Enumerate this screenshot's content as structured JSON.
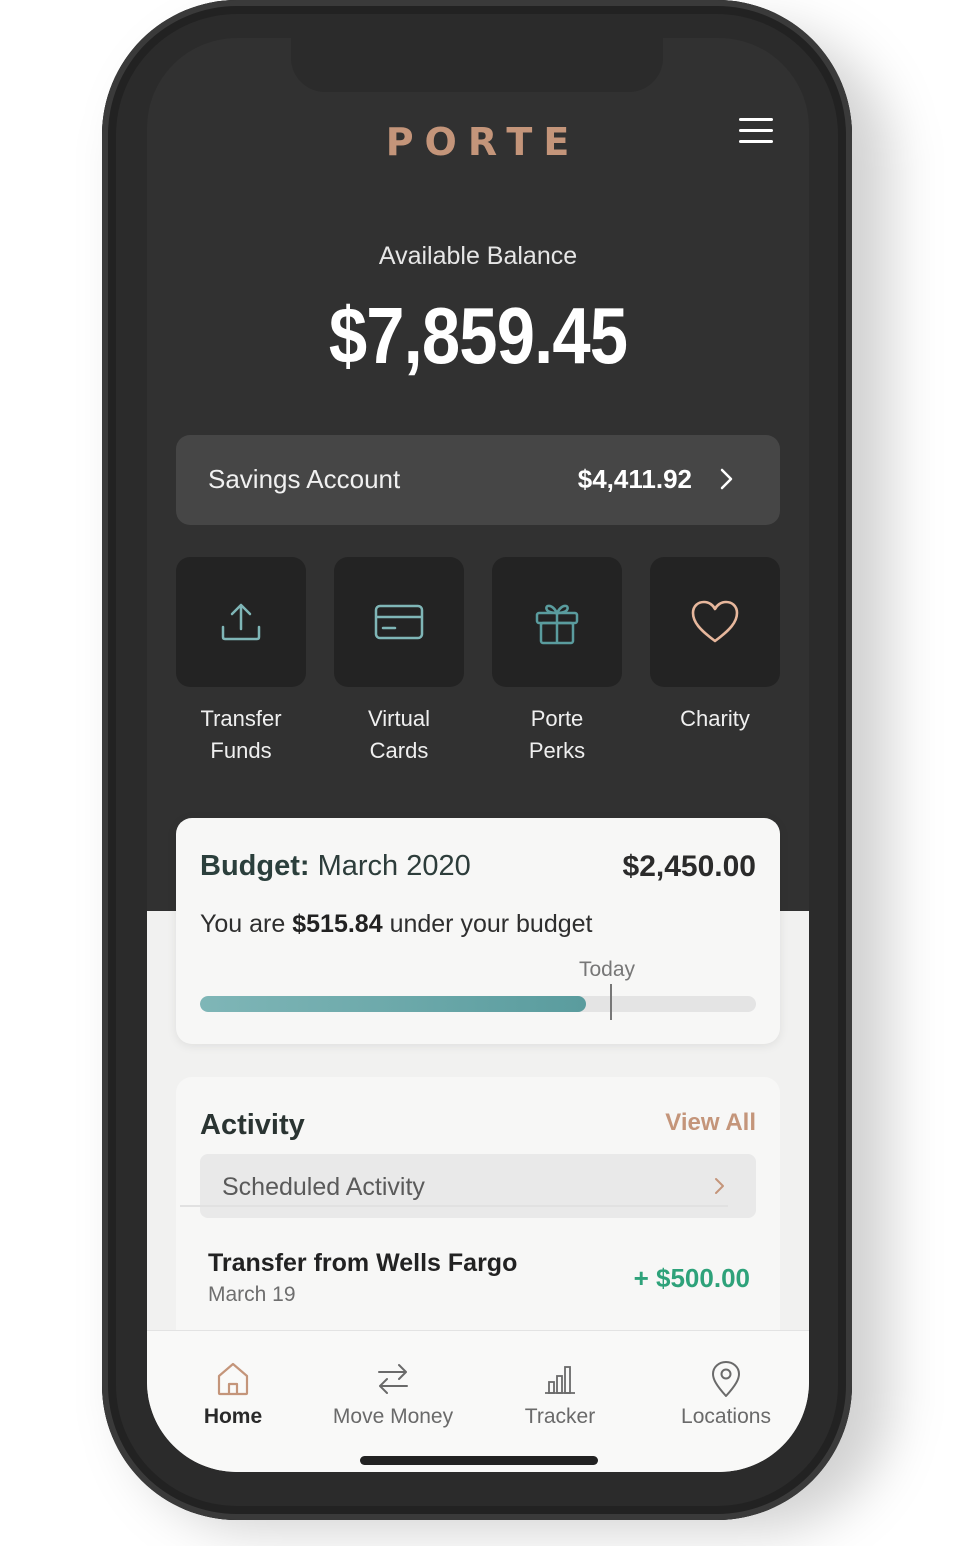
{
  "app": {
    "logo": "PORTE",
    "colors": {
      "accent": "#c4957a",
      "teal": "#5a9c9e",
      "positive": "#2ea27a",
      "dark_bg": "#313131"
    }
  },
  "balance": {
    "label": "Available Balance",
    "value": "$7,859.45"
  },
  "savings": {
    "label": "Savings Account",
    "value": "$4,411.92"
  },
  "actions": [
    {
      "label": "Transfer\nFunds",
      "icon": "upload-icon"
    },
    {
      "label": "Virtual\nCards",
      "icon": "card-icon"
    },
    {
      "label": "Porte\nPerks",
      "icon": "gift-icon"
    },
    {
      "label": "Charity",
      "icon": "heart-icon"
    }
  ],
  "budget": {
    "title_bold": "Budget:",
    "title_period": "March 2020",
    "amount": "$2,450.00",
    "status_prefix": "You are",
    "status_amount": "$515.84",
    "status_suffix": "under your budget",
    "today_label": "Today",
    "progress_fraction": 0.695,
    "today_fraction": 0.74
  },
  "activity": {
    "title": "Activity",
    "view_all": "View All",
    "scheduled_label": "Scheduled Activity",
    "transactions": [
      {
        "name": "Transfer from Wells Fargo",
        "date": "March 19",
        "amount": "+ $500.00"
      }
    ]
  },
  "tabs": [
    {
      "label": "Home",
      "icon": "home-icon",
      "active": true
    },
    {
      "label": "Move Money",
      "icon": "transfer-arrows-icon",
      "active": false
    },
    {
      "label": "Tracker",
      "icon": "bar-chart-icon",
      "active": false
    },
    {
      "label": "Locations",
      "icon": "location-pin-icon",
      "active": false
    }
  ]
}
